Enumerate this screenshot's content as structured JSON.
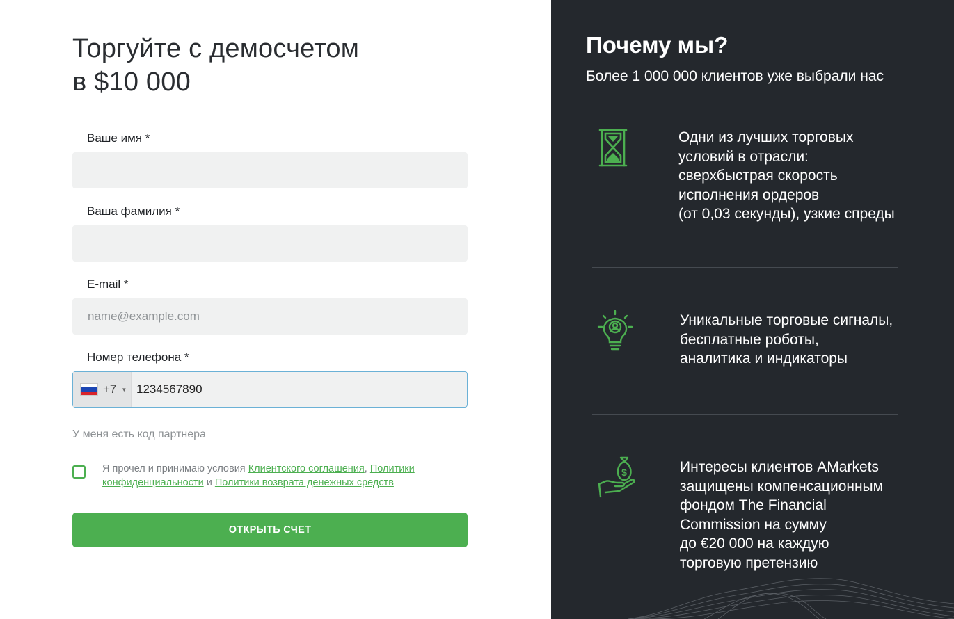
{
  "form": {
    "title_line1": "Торгуйте с демосчетом",
    "title_line2": "в $10 000",
    "first_name_label": "Ваше имя *",
    "first_name_value": "",
    "last_name_label": "Ваша фамилия *",
    "last_name_value": "",
    "email_label": "E-mail *",
    "email_placeholder": "name@example.com",
    "phone_label": "Номер телефона *",
    "phone_dial_code": "+7",
    "phone_value": "1234567890",
    "partner_link": "У меня есть код партнера",
    "agree_text_1": "Я прочел и принимаю условия ",
    "agree_link_1": "Клиентского соглашения",
    "agree_sep_1": ", ",
    "agree_link_2": "Политики конфиденциальности",
    "agree_sep_2": " и ",
    "agree_link_3": "Политики возврата денежных средств",
    "submit_label": "ОТКРЫТЬ СЧЕТ"
  },
  "promo": {
    "heading": "Почему мы?",
    "subheading": "Более 1 000 000 клиентов уже выбрали нас",
    "features": [
      {
        "icon": "hourglass-icon",
        "lines": [
          "Одни из лучших торговых",
          "условий в отрасли:",
          "сверхбыстрая скорость",
          "исполнения ордеров",
          "(от 0,03 секунды), узкие спреды"
        ]
      },
      {
        "icon": "lightbulb-icon",
        "lines": [
          "Уникальные торговые сигналы,",
          "бесплатные роботы,",
          "аналитика и индикаторы"
        ]
      },
      {
        "icon": "money-bag-hand-icon",
        "lines": [
          "Интересы клиентов AMarkets",
          "защищены компенсационным",
          "фондом The Financial",
          "Commission на сумму",
          "до €20 000 на каждую",
          "торговую претензию"
        ]
      }
    ]
  },
  "colors": {
    "accent": "#4caf50",
    "panel": "#24282d",
    "field": "#f0f1f1"
  }
}
